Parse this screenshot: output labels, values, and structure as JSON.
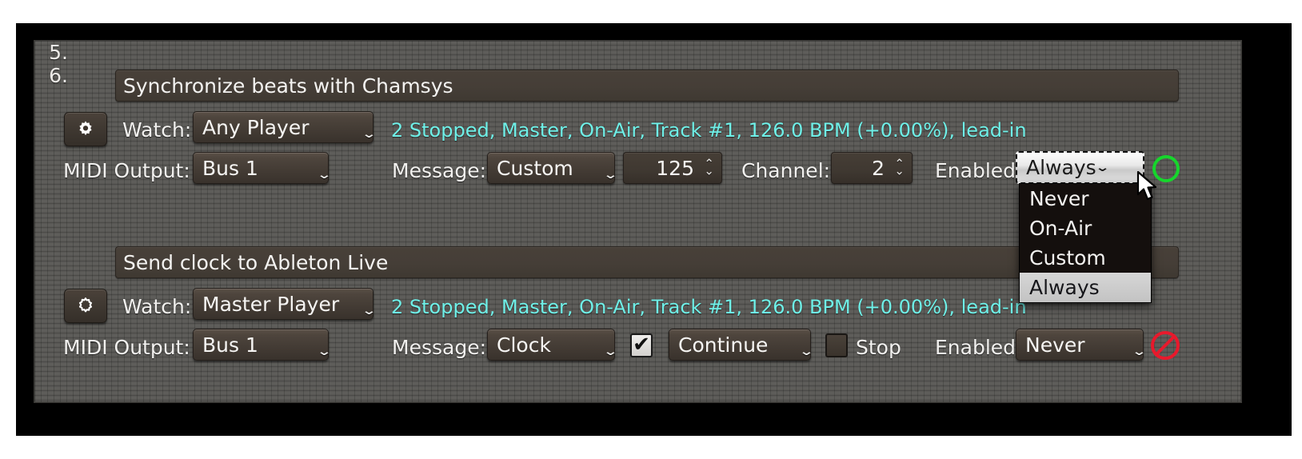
{
  "app": {
    "status_color_active": "#6ff0e8",
    "indicator_green": "#16d62c",
    "indicator_red": "#e8192c"
  },
  "rows": [
    {
      "index": "5.",
      "title": "Synchronize beats with Chamsys",
      "gear_icon": "gear-filled-icon",
      "watch_label": "Watch:",
      "watch_value": "Any Player",
      "status": "2 Stopped, Master, On-Air, Track #1, 126.0 BPM (+0.00%), lead-in",
      "midi_output_label": "MIDI Output:",
      "midi_output_value": "Bus 1",
      "message_label": "Message:",
      "message_value": "Custom",
      "custom_number": "125",
      "channel_label": "Channel:",
      "channel_value": "2",
      "enabled_label": "Enabled:",
      "enabled_value": "Always",
      "indicator": "enabled-green-circle-icon"
    },
    {
      "index": "6.",
      "title": "Send clock to Ableton Live",
      "gear_icon": "gear-outline-icon",
      "watch_label": "Watch:",
      "watch_value": "Master Player",
      "status": "2 Stopped, Master, On-Air, Track #1, 126.0 BPM (+0.00%), lead-in",
      "midi_output_label": "MIDI Output:",
      "midi_output_value": "Bus 1",
      "message_label": "Message:",
      "message_value": "Clock",
      "continue_checkbox_checked": "✔",
      "continue_value": "Continue",
      "stop_label": "Stop",
      "enabled_label": "Enabled:",
      "enabled_value": "Never",
      "indicator": "disabled-red-no-entry-icon"
    }
  ],
  "dropdown": {
    "open_for": "enabled",
    "selected": "Always",
    "options": [
      "Never",
      "On-Air",
      "Custom",
      "Always"
    ],
    "caret": "⌄"
  },
  "glyphs": {
    "caret_down": "⌄",
    "spin_up": "⌃",
    "spin_down": "⌄"
  }
}
